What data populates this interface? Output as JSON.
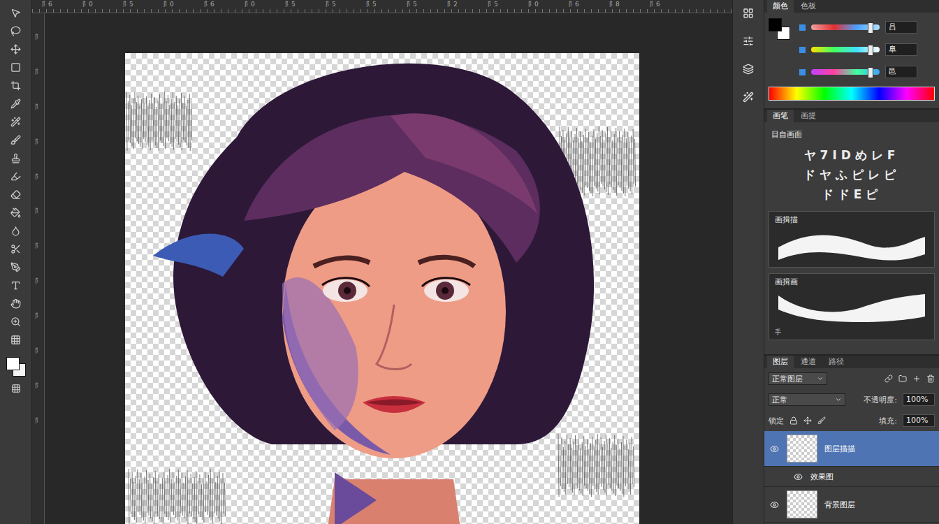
{
  "rulers": {
    "top": [
      "阝6",
      "阝0",
      "阝5",
      "阝0",
      "阝6",
      "阝0",
      "阝5",
      "阝5",
      "阝5",
      "阝5",
      "阝2",
      "阝5",
      "阝0",
      "阝6",
      "阝8",
      "阝6"
    ],
    "left": [
      "阝",
      "阝",
      "阝",
      "阝",
      "阝",
      "阝",
      "阝",
      "阝",
      "阝",
      "阝",
      "阝",
      "阝"
    ]
  },
  "color_panel": {
    "tabs": [
      {
        "label": "颜色",
        "selected": true
      },
      {
        "label": "色板",
        "selected": false
      }
    ],
    "sliders": [
      {
        "level": 0.88,
        "value": "吕"
      },
      {
        "level": 0.88,
        "value": "阜"
      },
      {
        "level": 0.88,
        "value": "邑"
      }
    ]
  },
  "brush_panel": {
    "tabs": [
      {
        "label": "画笔",
        "selected": true
      },
      {
        "label": "画提",
        "selected": false
      }
    ],
    "title": "目自画面",
    "presets": [
      "ヤ7IDめレF",
      "ドヤふピレピ",
      "ドドЕピ"
    ],
    "strokes": [
      {
        "label": "画揖描"
      },
      {
        "label": "画揖画",
        "note": "手"
      }
    ]
  },
  "layers_panel": {
    "tabs": [
      {
        "label": "图层",
        "selected": true
      },
      {
        "label": "通道",
        "selected": false
      },
      {
        "label": "路径",
        "selected": false
      }
    ],
    "filter": "正常图层",
    "blend_mode": "正常",
    "opacity_label": "不透明度:",
    "opacity": "100%",
    "lock_label": "锁定",
    "fill_label": "填充:",
    "fill": "100%",
    "layers": [
      {
        "name": "图层描描",
        "kind": "layer",
        "selected": true,
        "visible": true
      },
      {
        "name": "效果图",
        "kind": "effect",
        "selected": false,
        "visible": true
      },
      {
        "name": "背景图层",
        "kind": "layer",
        "selected": false,
        "visible": true
      }
    ]
  }
}
